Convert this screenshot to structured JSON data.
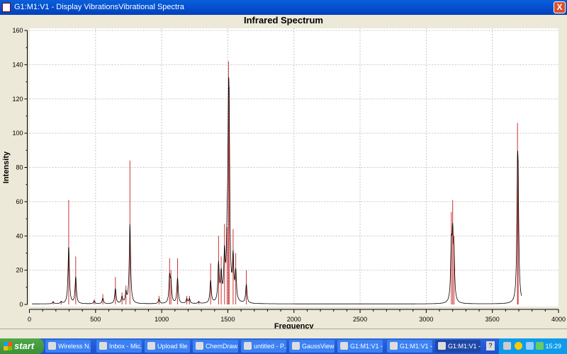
{
  "window": {
    "title": "G1:M1:V1 - Display VibrationsVibrational Spectra",
    "close_label": "X"
  },
  "chart_data": {
    "type": "line",
    "title": "Infrared Spectrum",
    "xlabel": "Frequency",
    "ylabel": "Intensity",
    "xlim": [
      0,
      4000
    ],
    "ylim": [
      0,
      160
    ],
    "xticks": [
      0,
      500,
      1000,
      1500,
      2000,
      2500,
      3000,
      3500,
      4000
    ],
    "yticks": [
      0,
      20,
      40,
      60,
      80,
      100,
      120,
      140,
      160
    ],
    "grid": true,
    "colors": {
      "curve": "#000000",
      "sticks": "#cc3333"
    },
    "sticks": [
      [
        180,
        2
      ],
      [
        240,
        2
      ],
      [
        297,
        61
      ],
      [
        350,
        28
      ],
      [
        490,
        3
      ],
      [
        555,
        6
      ],
      [
        650,
        16
      ],
      [
        700,
        7
      ],
      [
        730,
        11
      ],
      [
        760,
        84
      ],
      [
        980,
        5
      ],
      [
        1060,
        27
      ],
      [
        1070,
        20
      ],
      [
        1120,
        27
      ],
      [
        1190,
        5
      ],
      [
        1210,
        5
      ],
      [
        1280,
        2
      ],
      [
        1370,
        24
      ],
      [
        1430,
        40
      ],
      [
        1450,
        28
      ],
      [
        1475,
        47
      ],
      [
        1495,
        45
      ],
      [
        1505,
        142
      ],
      [
        1510,
        127
      ],
      [
        1540,
        44
      ],
      [
        1560,
        30
      ],
      [
        1640,
        20
      ],
      [
        3190,
        54
      ],
      [
        3200,
        61
      ],
      [
        3210,
        40
      ],
      [
        3690,
        106
      ],
      [
        3695,
        84
      ]
    ]
  },
  "taskbar": {
    "start": "start",
    "tasks": [
      "Wireless N...",
      "Inbox - Mic...",
      "Upload file ...",
      "ChemDraw...",
      "untitled - P...",
      "GaussView ...",
      "G1:M1:V1 -...",
      "G1:M1:V1 -...",
      "G1:M1:V1 -..."
    ],
    "help": "?",
    "clock": "15:29"
  }
}
